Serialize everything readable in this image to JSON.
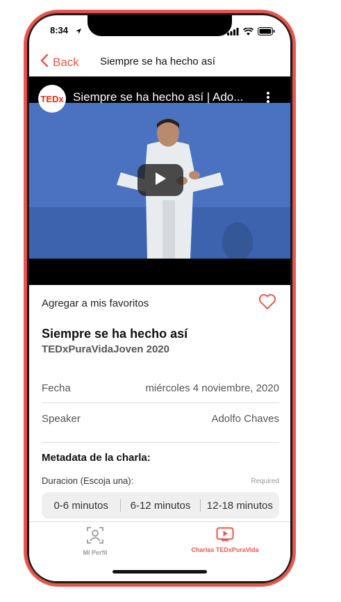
{
  "status": {
    "time": "8:34"
  },
  "nav": {
    "back_label": "Back",
    "title": "Siempre se ha hecho así"
  },
  "video": {
    "channel_logo": "TEDx",
    "title": "Siempre se ha hecho así | Ado..."
  },
  "favorites": {
    "label": "Agregar a mis favoritos"
  },
  "talk": {
    "title": "Siempre se ha hecho así",
    "event": "TEDxPuraVidaJoven 2020",
    "rows": [
      {
        "key": "Fecha",
        "value": "miércoles 4 noviembre, 2020"
      },
      {
        "key": "Speaker",
        "value": "Adolfo Chaves"
      }
    ]
  },
  "metadata": {
    "title": "Metadata de la charla:",
    "duration_label": "Duracion (Escoja una):",
    "required": "Required",
    "options": [
      "0-6 minutos",
      "6-12 minutos",
      "12-18 minutos"
    ]
  },
  "tabs": [
    {
      "label": "Mi Perfil",
      "icon": "profile-icon",
      "active": false
    },
    {
      "label": "Charlas TEDxPuraVida",
      "icon": "play-icon",
      "active": true
    }
  ],
  "colors": {
    "accent": "#e8574d",
    "inactive": "#9a9a9a"
  }
}
